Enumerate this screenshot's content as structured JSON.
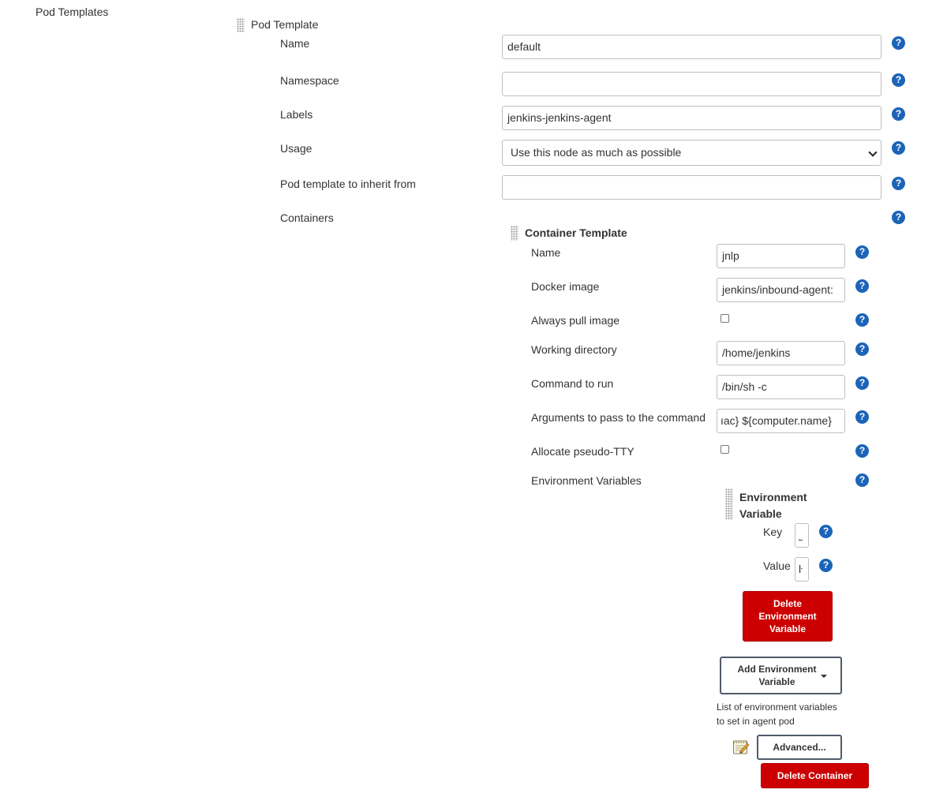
{
  "section_label": "Pod Templates",
  "pod_template": {
    "header": "Pod Template",
    "name_label": "Name",
    "name_value": "default",
    "namespace_label": "Namespace",
    "namespace_value": "",
    "labels_label": "Labels",
    "labels_value": "jenkins-jenkins-agent",
    "usage_label": "Usage",
    "usage_value": "Use this node as much as possible",
    "inherit_label": "Pod template to inherit from",
    "inherit_value": "",
    "containers_label": "Containers"
  },
  "container": {
    "header": "Container Template",
    "name_label": "Name",
    "name_value": "jnlp",
    "image_label": "Docker image",
    "image_value": "jenkins/inbound-agent:",
    "always_pull_label": "Always pull image",
    "always_pull_checked": false,
    "workdir_label": "Working directory",
    "workdir_value": "/home/jenkins",
    "command_label": "Command to run",
    "command_value": "/bin/sh -c",
    "args_label": "Arguments to pass to the command",
    "args_value": "ıac} ${computer.name}",
    "tty_label": "Allocate pseudo-TTY",
    "tty_checked": false,
    "env_label": "Environment Variables"
  },
  "env_var": {
    "header_line1": "Environment",
    "header_line2": "Variable",
    "key_label": "Key",
    "key_value": "˷",
    "value_label": "Value",
    "value_value": "ŀ",
    "delete_line1": "Delete",
    "delete_line2": "Environment",
    "delete_line3": "Variable"
  },
  "add_env": {
    "line1": "Add Environment",
    "line2": "Variable"
  },
  "env_description_line1": "List of environment variables",
  "env_description_line2": "to set in agent pod",
  "advanced_label": "Advanced...",
  "delete_container_label": "Delete Container",
  "help_glyph": "?",
  "colors": {
    "help_icon": "#1c64b8",
    "danger_button": "#cc0000",
    "input_border": "#bfbfbf"
  }
}
